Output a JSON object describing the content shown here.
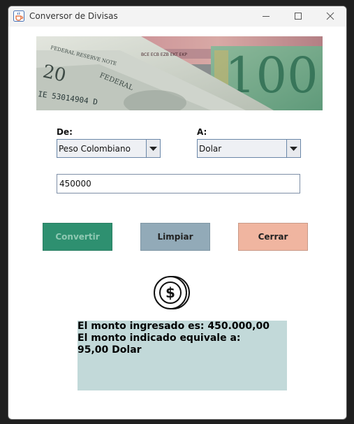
{
  "window": {
    "title": "Conversor de Divisas"
  },
  "form": {
    "from_label": "De:",
    "to_label": "A:",
    "from_currency": "Peso Colombiano",
    "to_currency": "Dolar",
    "amount": "450000"
  },
  "buttons": {
    "convert": "Convertir",
    "clear": "Limpiar",
    "close": "Cerrar"
  },
  "result": {
    "line1": "El monto ingresado es: 450.000,00",
    "line2": "El monto indicado equivale a:",
    "line3": "95,00 Dolar"
  },
  "colors": {
    "convert_bg": "#2e9070",
    "convert_text": "#8fc9b3",
    "clear_bg": "#92aab8",
    "close_bg": "#f0b5a0",
    "result_bg": "#c2d9d9"
  },
  "icons": {
    "app": "java-cup-icon",
    "coin": "dollar-coin-icon"
  }
}
